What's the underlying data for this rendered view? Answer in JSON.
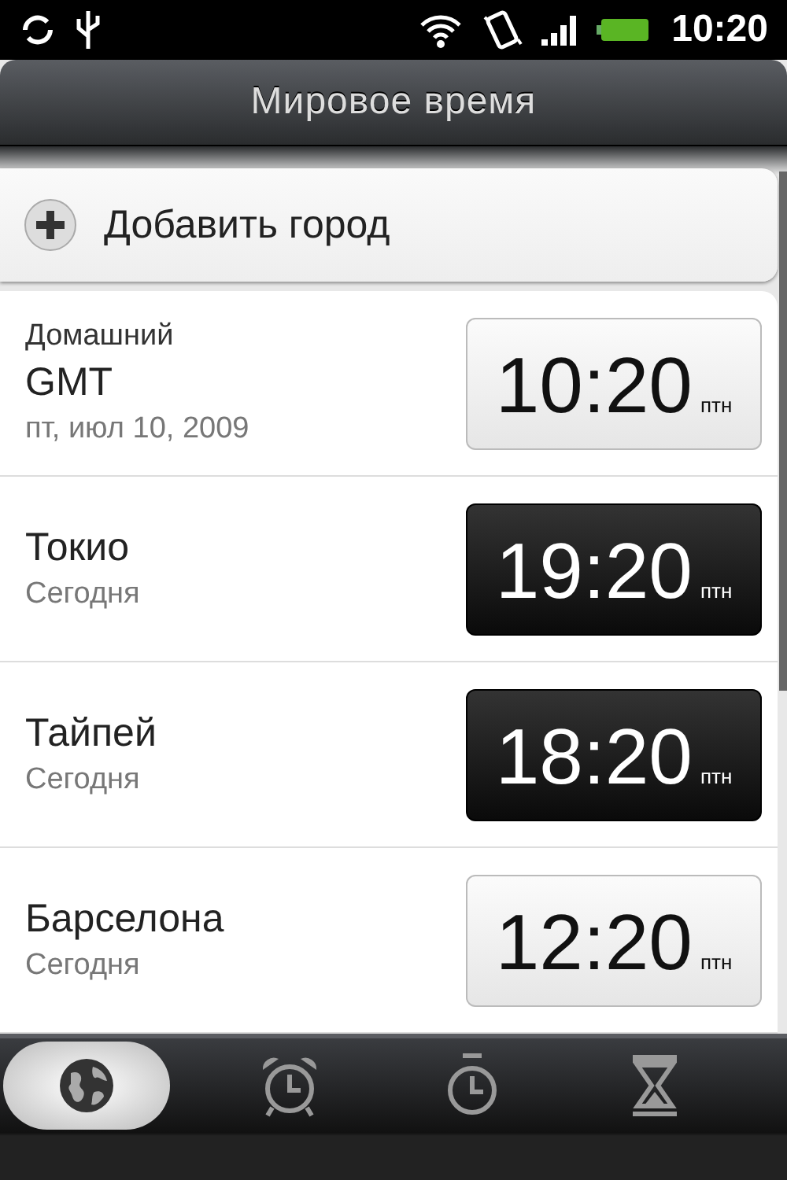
{
  "status_bar": {
    "time": "10:20"
  },
  "title": "Мировое время",
  "add_button": {
    "label": "Добавить город"
  },
  "cities": [
    {
      "label": "Домашний",
      "name": "GMT",
      "date": "пт, июл 10, 2009",
      "time": "10:20",
      "day": "птн",
      "dark": false
    },
    {
      "name": "Токио",
      "date": "Сегодня",
      "time": "19:20",
      "day": "птн",
      "dark": true
    },
    {
      "name": "Тайпей",
      "date": "Сегодня",
      "time": "18:20",
      "day": "птн",
      "dark": true
    },
    {
      "name": "Барселона",
      "date": "Сегодня",
      "time": "12:20",
      "day": "птн",
      "dark": false
    }
  ],
  "tabs": [
    {
      "kind": "globe",
      "selected": true
    },
    {
      "kind": "alarm",
      "selected": false
    },
    {
      "kind": "stopwatch",
      "selected": false
    },
    {
      "kind": "timer",
      "selected": false
    }
  ]
}
